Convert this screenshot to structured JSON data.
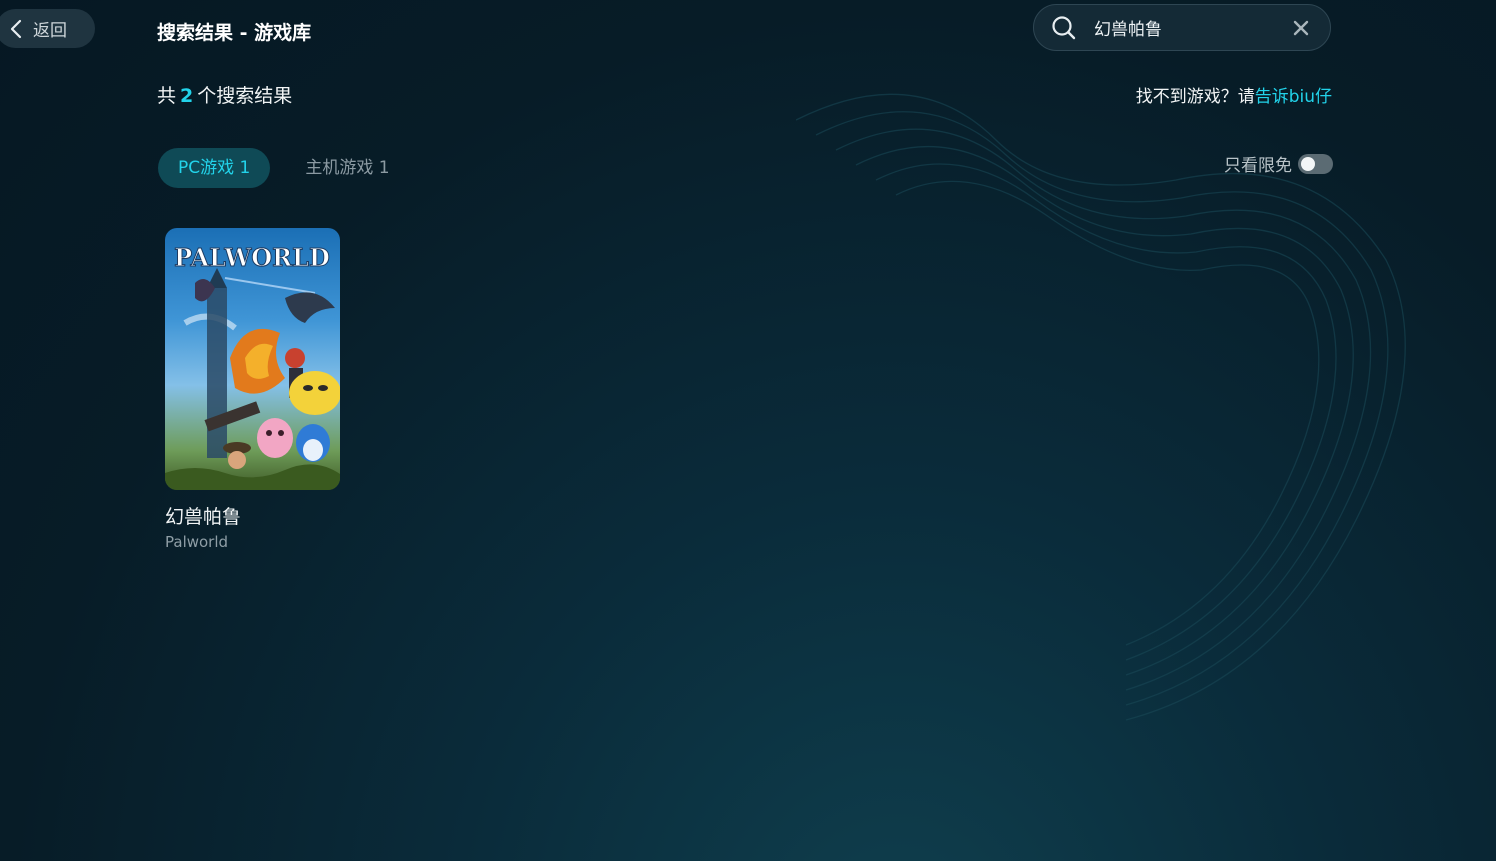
{
  "header": {
    "back_label": "返回",
    "page_title": "搜索结果 - 游戏库"
  },
  "search": {
    "value": "幻兽帕鲁",
    "placeholder": ""
  },
  "results": {
    "prefix": "共",
    "count": "2",
    "suffix": "个搜索结果"
  },
  "feedback": {
    "text": "找不到游戏？请",
    "link": "告诉biu仔"
  },
  "tabs": [
    {
      "label": "PC游戏 1",
      "active": true
    },
    {
      "label": "主机游戏 1",
      "active": false
    }
  ],
  "filter": {
    "free_only_label": "只看限免",
    "free_only_on": false
  },
  "games": [
    {
      "title": "幻兽帕鲁",
      "subtitle": "Palworld",
      "cover_logo": "PALWORLD"
    }
  ],
  "colors": {
    "accent": "#22d3ea",
    "background": "#071c27",
    "tab_active_bg": "#0f4a56"
  }
}
